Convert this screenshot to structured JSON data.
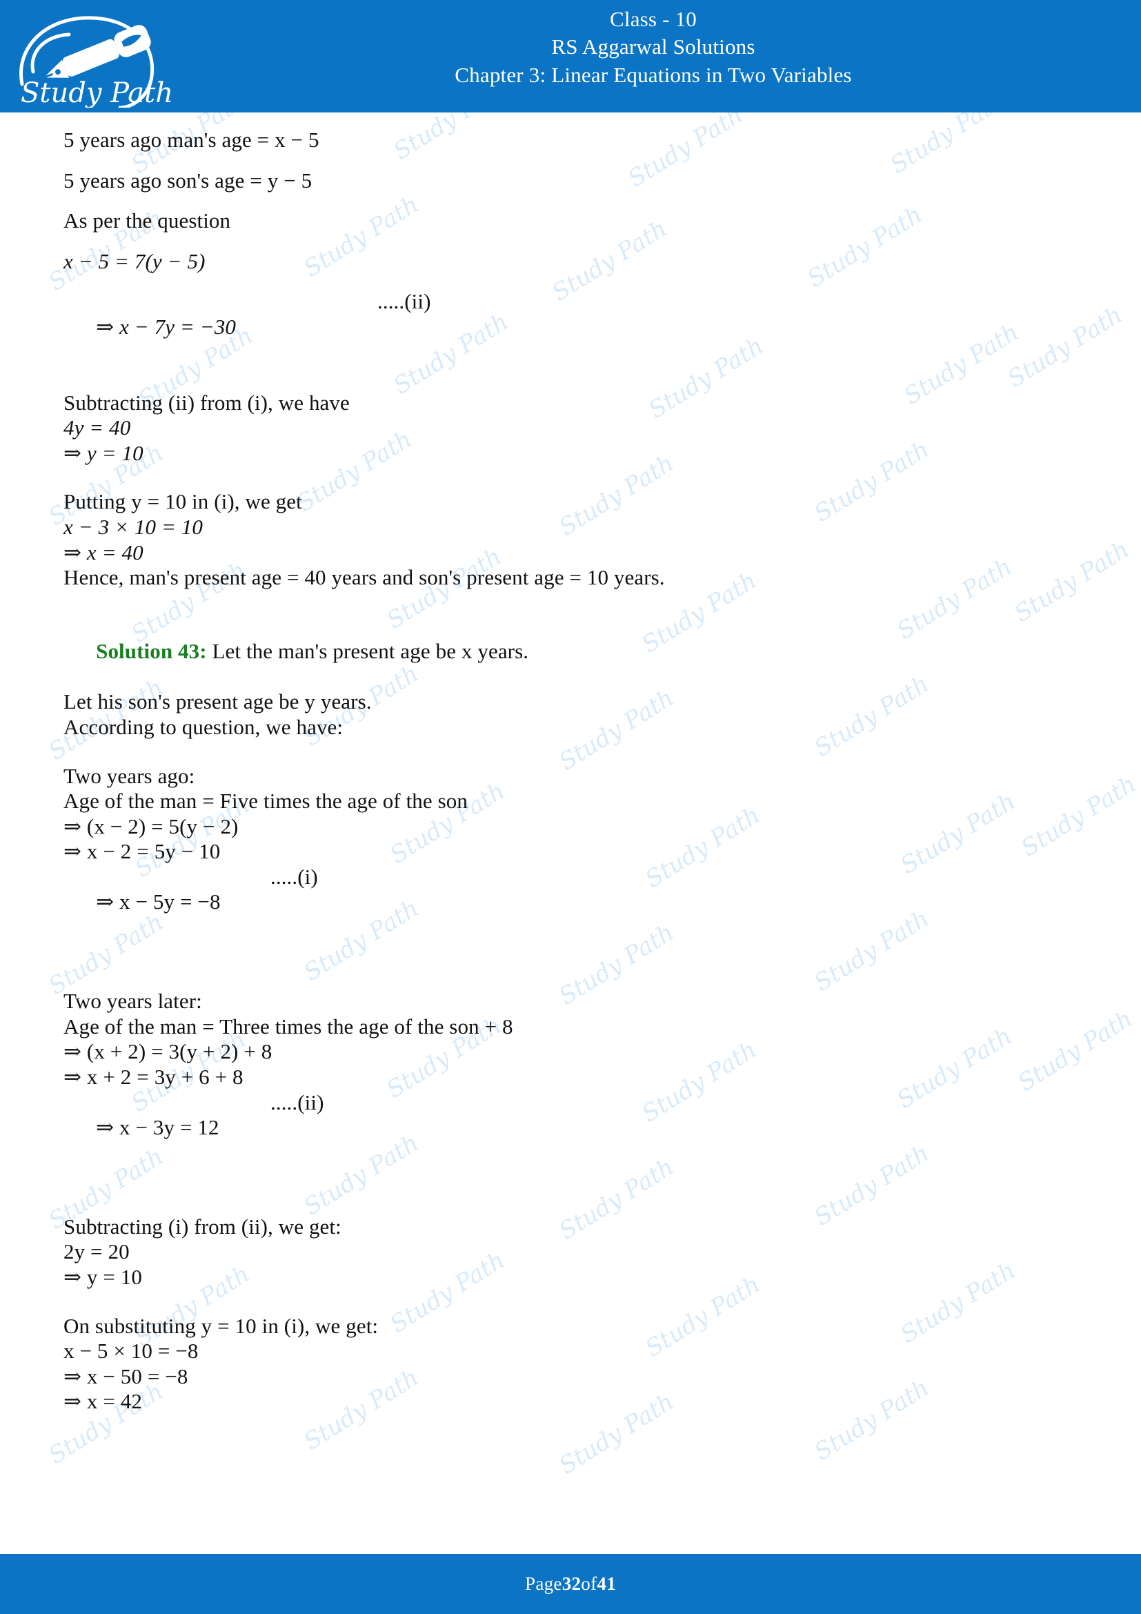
{
  "theme": {
    "header_blue": "#0b74c4",
    "footer_blue": "#0b74c4",
    "solution_green": "#1a7d22",
    "watermark_blue": "#d3e7f7",
    "text_color": "#111111"
  },
  "header": {
    "logo_text": "Study Path",
    "logo_icon": "fountain-pen-icon",
    "class_line": "Class - 10",
    "book_line": "RS Aggarwal Solutions",
    "chapter_line": "Chapter 3: Linear Equations in Two Variables"
  },
  "watermark": {
    "text": "Study Path"
  },
  "body": {
    "l01": "5 years ago man's age = x − 5",
    "l02": "5 years ago son's age = y − 5",
    "l03": "As per the question",
    "l04": "x − 5 = 7(y − 5)",
    "l05": "⇒ x − 7y = −30",
    "l05_ref": ".....(ii)",
    "l06": "Subtracting (ii) from (i), we have",
    "l07": "4y = 40",
    "l08": "⇒ y = 10",
    "l09": "Putting y = 10 in (i), we get",
    "l10": "x − 3 × 10 = 10",
    "l11": "⇒ x = 40",
    "l12": "Hence, man's present age = 40 years and son's present age = 10 years.",
    "sol_label": "Solution 43:",
    "l13": " Let the man's present age be x years.",
    "l14": "Let his son's present age be y years.",
    "l15": "According to question, we have:",
    "l16": "Two years ago:",
    "l17": "Age of the man = Five times the age of the son",
    "l18": "⇒ (x − 2) = 5(y − 2)",
    "l19": "⇒ x − 2 = 5y − 10",
    "l20": "⇒ x − 5y = −8",
    "l20_ref": ".....(i)",
    "l21": "Two years later:",
    "l22": "Age of the man = Three times the age of the son + 8",
    "l23": "⇒ (x + 2) = 3(y + 2) + 8",
    "l24": "⇒ x + 2 = 3y + 6 + 8",
    "l25": "⇒ x − 3y = 12",
    "l25_ref": ".....(ii)",
    "l26": "Subtracting (i) from (ii), we get:",
    "l27": "2y = 20",
    "l28": "⇒ y = 10",
    "l29": "On substituting y = 10 in (i), we get:",
    "l30": "x − 5 × 10 = −8",
    "l31": "⇒ x − 50 = −8",
    "l32": "⇒ x = 42"
  },
  "footer": {
    "prefix": "Page ",
    "current_page": "32",
    "middle": " of ",
    "total_pages": "41"
  }
}
